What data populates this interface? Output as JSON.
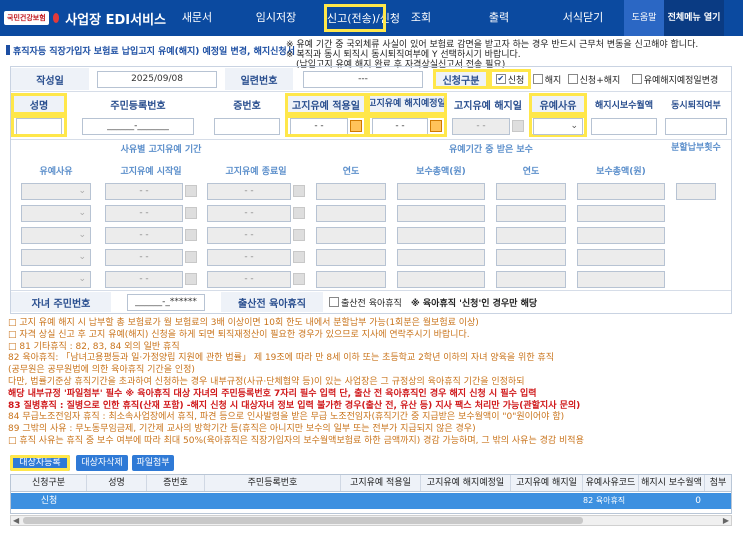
{
  "header": {
    "logo_text": "국민건강보험",
    "app_title": "사업장 EDI서비스",
    "menu": [
      {
        "label": "새문서",
        "width": 62
      },
      {
        "label": "임시저장",
        "width": 96
      },
      {
        "label": "신고(전송)/신청",
        "width": 62,
        "highlight": true
      },
      {
        "label": "조회",
        "width": 70
      },
      {
        "label": "출력",
        "width": 86
      },
      {
        "label": "서식닫기",
        "width": 82
      }
    ],
    "help_label": "도움말",
    "all_menu_label": "전체메뉴 열기"
  },
  "page_title": "휴직자등 직장가입자 보험료 납입고지 유예(해지) 예정일 변경, 해지신청서",
  "notices": [
    "※ 유예 기간 중 국외체류 사실이 있어 보험료 감면을 받고자 하는 경우 반드시 근무처 변동을 신고해야 합니다.",
    "※ 복직과 동시 퇴직시 동시퇴직여부에 Y 선택하시기 바랍니다.",
    "(납입고지 유예 해지 완료 후 자격상실신고서 전송 필요)"
  ],
  "form": {
    "write_date_label": "작성일",
    "write_date_value": "2025/09/08",
    "serial_label": "일련번호",
    "serial_value": "---",
    "apply_type_label": "신청구분",
    "apply_type_options": [
      {
        "label": "신청",
        "checked": true
      },
      {
        "label": "해지",
        "checked": false
      },
      {
        "label": "신청+해지",
        "checked": false
      },
      {
        "label": "유예해지예정일변경",
        "checked": false
      }
    ],
    "col_name": "성명",
    "col_rrn": "주민등록번호",
    "col_cert": "증번호",
    "col_apply_date": "고지유예 적용일",
    "col_planned_end": "고지유예 해지예정일",
    "col_end_date": "고지유예 해지일",
    "col_reason": "유예사유",
    "col_pay_at_end": "해지시보수월액",
    "col_retire": "동시퇴직여부",
    "rrn_placeholder": "______-_______",
    "date_placeholder": "- -",
    "section_reason_title": "사유별 고지유예 기간",
    "section_pay_title": "유예기간 중 받은 보수",
    "installment_label": "분할납부횟수",
    "sub_reason": "유예사유",
    "sub_start": "고지유예 시작일",
    "sub_end": "고지유예 종료일",
    "sub_year1": "연도",
    "sub_total1": "보수총액(원)",
    "sub_year2": "연도",
    "sub_total2": "보수총액(원)",
    "child_rrn_label": "자녀 주민번호",
    "child_rrn_value": "______-_******",
    "prenatal_label": "출산전 육아휴직",
    "prenatal_check_label": "출산전 육아휴직",
    "prenatal_note": "※ 육아휴직 '신청'인 경우만 해당"
  },
  "notes": [
    {
      "text": "□ 고지 유예 해지 시 납부할 총 보험료가 월 보험료의 3배 이상이면 10회 한도 내에서 분할납부 가능(1회분은 월보험료 이상)",
      "cls": "c-org"
    },
    {
      "text": "□ 자격 상실 신고 후 고지 유예(해지) 신청을 하게 되면 퇴직재정산이 필요한 경우가 있으므로 지사에 연락주시기 바랍니다.",
      "cls": "c-org"
    },
    {
      "text": "□ 81 기타휴직 : 82, 83, 84 외의 일반 휴직",
      "cls": "c-org"
    },
    {
      "text": "    82 육아휴직: 「남녀고용평등과 일·가정양립 지원에 관한 법률」 제 19조에 따라 만 8세 이하 또는 초등학교 2학년 이하의 자녀 양육을 위한 휴직",
      "cls": "c-org"
    },
    {
      "text": "                (공무원은 공무원법에 의한 육아휴직 기간을 인정)",
      "cls": "c-org"
    },
    {
      "text": "                다만, 법률기준상 휴직기간을 초과하여 신청하는 경우 내부규정(사규·단체협약 등)이 있는 사업장은 그 규정상의 육아휴직 기간을 인정하되",
      "cls": "c-org"
    },
    {
      "text": "                해당 내부규정 '파일첨부' 필수  ※ 육아휴직 대상 자녀의 주민등록번호 7자리 필수 입력 단, 출산 전 육아휴직인 경우 해지 신청 시 필수 입력",
      "cls": "c-red"
    },
    {
      "text": "    83 질병휴직 : 질병으로 인한 휴직(산재 포함)                        -해지 신청 시 대상자녀 정보 입력 불가한 경우(출산 전, 유산 등) 지사 팩스 처리만 가능(관할지사 문의)",
      "cls": "c-red"
    },
    {
      "text": "    84 무급노조전임자 휴직 : 최소속사업장에서 휴직, 파견 등으로 인사발령을 받은 무급 노조전임자(휴직기간 중 지급받은 보수월액이 \"0\"원이어야 함)",
      "cls": "c-org"
    },
    {
      "text": "    89 그밖의 사유 : 무노동무임금제, 기간제 교사의 방학기간 등(휴직은 아니지만 보수의 일부 또는 전부가 지급되지 않은 경우)",
      "cls": "c-org"
    },
    {
      "text": "□ 휴직 사유는 휴직 중 보수 여부에 따라 최대 50%(육아휴직은 직장가입자의 보수월액보험료 하한 금액까지) 경감 가능하며, 그 밖의 사유는 경감 비적용",
      "cls": "c-org"
    }
  ],
  "buttons": {
    "register": "대상자등록",
    "delete": "대상자삭제",
    "attach": "파일첨부"
  },
  "result": {
    "headers": [
      "신청구분",
      "성명",
      "증번호",
      "주민등록번호",
      "고지유예 적용일",
      "고지유예 해지예정일",
      "고지유예 해지일",
      "유예사유코드",
      "해지시 보수월액",
      "첨부"
    ],
    "row": [
      "신청",
      "",
      "",
      "",
      "",
      "",
      "",
      "82 육아휴직",
      "0",
      ""
    ]
  },
  "colors": {
    "header_bg": "#0b4aa0",
    "highlight": "#ffe74a",
    "label_blue": "#2a4f8f",
    "note_orange": "#c9741c",
    "note_red": "#d0191b",
    "selected_row": "#3d90e0"
  }
}
